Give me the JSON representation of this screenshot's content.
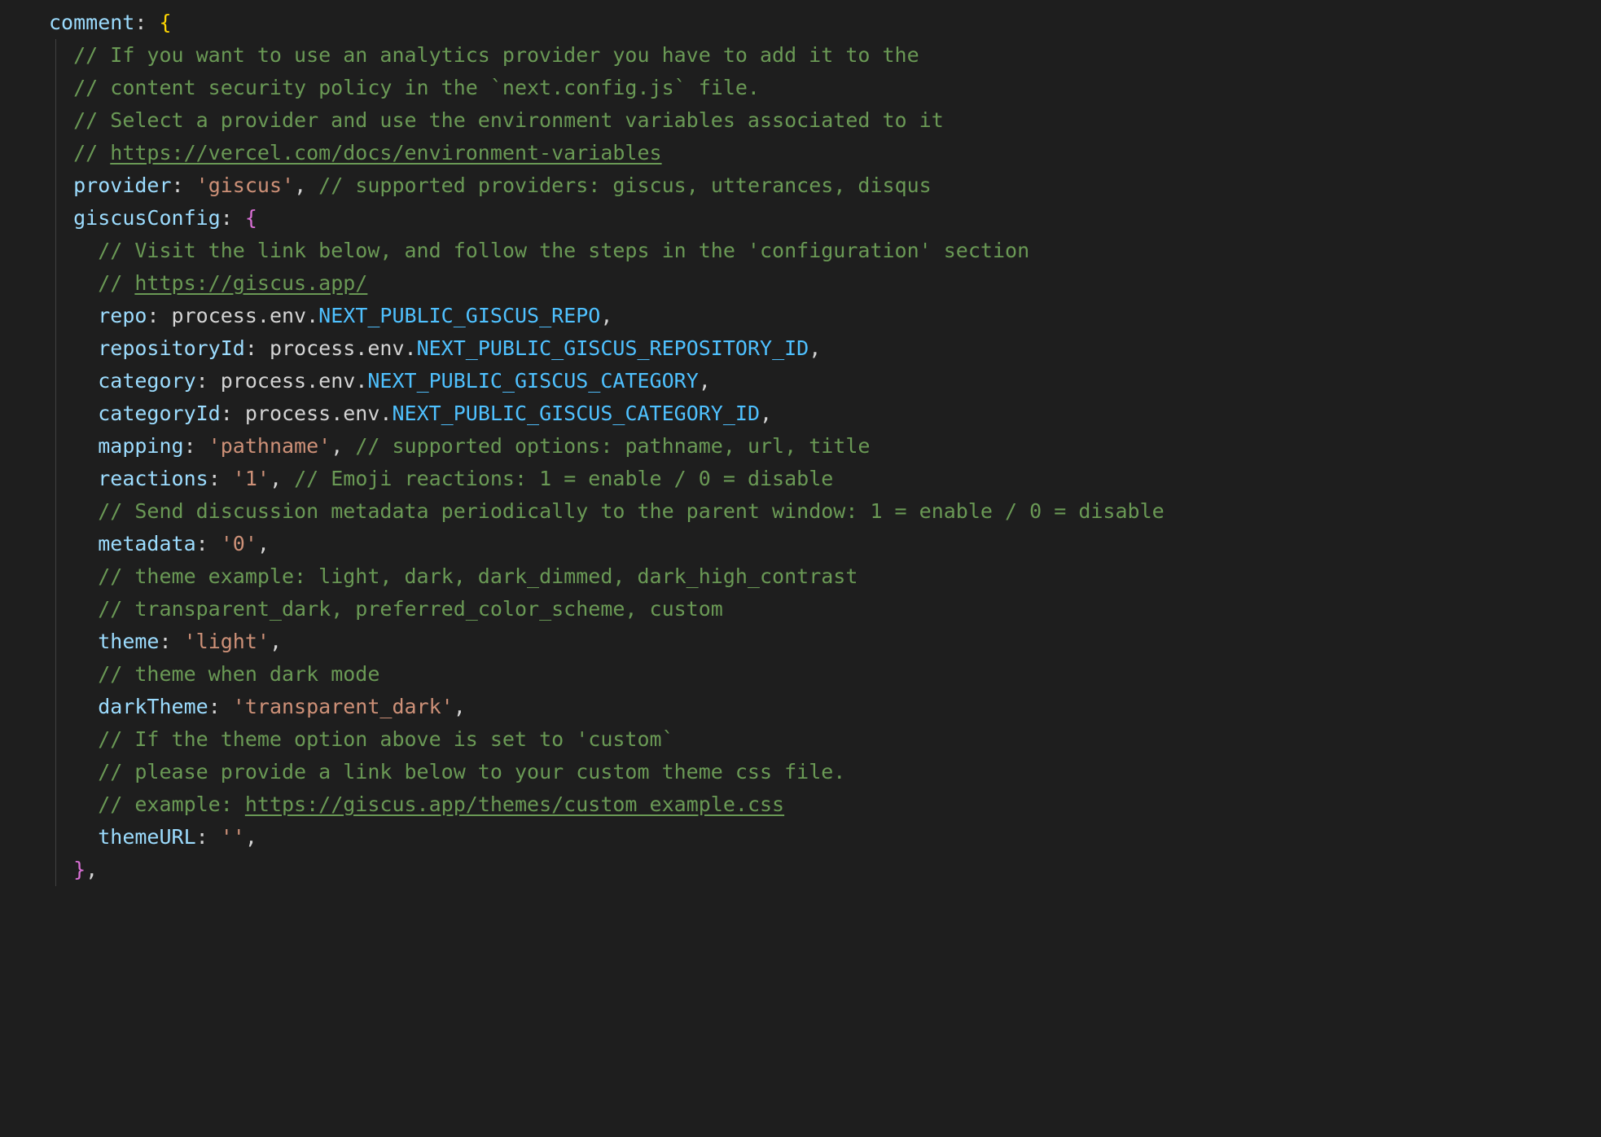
{
  "code": {
    "topKey": "comment",
    "comments": {
      "c1": "// If you want to use an analytics provider you have to add it to the",
      "c2": "// content security policy in the `next.config.js` file.",
      "c3": "// Select a provider and use the environment variables associated to it",
      "c4_prefix": "// ",
      "c4_link": "https://vercel.com/docs/environment-variables",
      "provider_comment": "// supported providers: giscus, utterances, disqus",
      "g1": "// Visit the link below, and follow the steps in the 'configuration' section",
      "g2_prefix": "// ",
      "g2_link": "https://giscus.app/",
      "mapping_comment": "// supported options: pathname, url, title",
      "reactions_comment": "// Emoji reactions: 1 = enable / 0 = disable",
      "metadata_pre": "// Send discussion metadata periodically to the parent window: 1 = enable / 0 = disable",
      "theme1": "// theme example: light, dark, dark_dimmed, dark_high_contrast",
      "theme2": "// transparent_dark, preferred_color_scheme, custom",
      "dark1": "// theme when dark mode",
      "custom1": "// If the theme option above is set to 'custom`",
      "custom2": "// please provide a link below to your custom theme css file.",
      "custom3_prefix": "// example: ",
      "custom3_link": "https://giscus.app/themes/custom_example.css"
    },
    "provider": {
      "key": "provider",
      "value": "'giscus'"
    },
    "giscusKey": "giscusConfig",
    "env_prefix": "process.env.",
    "giscus": {
      "repo": {
        "key": "repo",
        "env": "NEXT_PUBLIC_GISCUS_REPO"
      },
      "repositoryId": {
        "key": "repositoryId",
        "env": "NEXT_PUBLIC_GISCUS_REPOSITORY_ID"
      },
      "category": {
        "key": "category",
        "env": "NEXT_PUBLIC_GISCUS_CATEGORY"
      },
      "categoryId": {
        "key": "categoryId",
        "env": "NEXT_PUBLIC_GISCUS_CATEGORY_ID"
      },
      "mapping": {
        "key": "mapping",
        "value": "'pathname'"
      },
      "reactions": {
        "key": "reactions",
        "value": "'1'"
      },
      "metadata": {
        "key": "metadata",
        "value": "'0'"
      },
      "theme": {
        "key": "theme",
        "value": "'light'"
      },
      "darkTheme": {
        "key": "darkTheme",
        "value": "'transparent_dark'"
      },
      "themeURL": {
        "key": "themeURL",
        "value": "''"
      }
    }
  }
}
